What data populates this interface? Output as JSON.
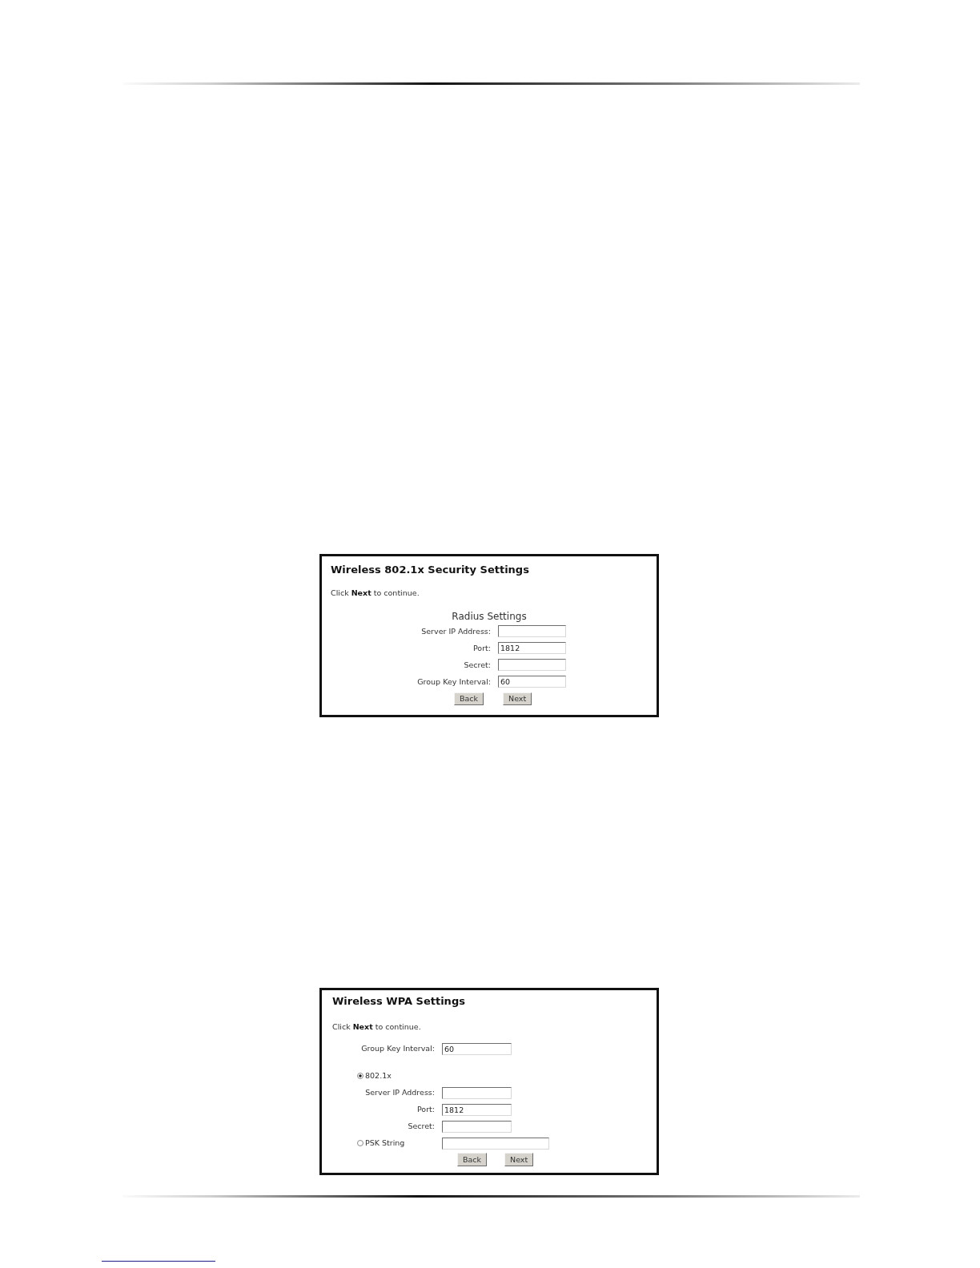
{
  "panels": [
    {
      "title": "Wireless 802.1x Security Settings",
      "instruction": "Click **Next** to continue.",
      "section_heading": "Radius Settings",
      "fields": [
        {
          "kind": "text",
          "label": "Server IP Address:"
        },
        {
          "kind": "text",
          "label": "Port:",
          "value": "1812"
        },
        {
          "kind": "text",
          "label": "Secret:"
        },
        {
          "kind": "text",
          "label": "Group Key Interval:",
          "value": "60"
        }
      ],
      "buttons": [
        "Back",
        "Next"
      ]
    },
    {
      "title": "Wireless WPA Settings",
      "instruction": "Click **Next** to continue.",
      "fields": [
        {
          "kind": "text",
          "label": "Group Key Interval:",
          "value": "60"
        },
        {
          "kind": "radio",
          "label": "802.1x",
          "selected": true
        },
        {
          "kind": "text",
          "label": "Server IP Address:"
        },
        {
          "kind": "text",
          "label": "Port:",
          "value": "1812"
        },
        {
          "kind": "text",
          "label": "Secret:"
        },
        {
          "kind": "radio_text",
          "label": "PSK String",
          "selected": false
        }
      ],
      "buttons": [
        "Back",
        "Next"
      ]
    }
  ]
}
